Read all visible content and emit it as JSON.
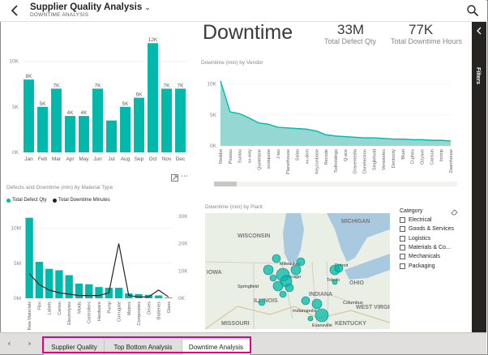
{
  "header": {
    "title": "Supplier Quality Analysis",
    "subtitle": "DOWNTIME ANALYSIS"
  },
  "filters": {
    "label": "Filters"
  },
  "downtime_heading": "Downtime",
  "kpis": [
    {
      "value": "33M",
      "label": "Total Defect Qty"
    },
    {
      "value": "77K",
      "label": "Total Downtime Hours"
    }
  ],
  "colors": {
    "teal": "#01b8aa",
    "teal_light": "#8ad4ce",
    "dark_line": "#252423",
    "accent_tab": "#e3008c"
  },
  "chart_data": [
    {
      "type": "bar",
      "title": "",
      "categories": [
        "Jan",
        "Feb",
        "Mar",
        "Apr",
        "May",
        "Jun",
        "Jul",
        "Aug",
        "Sep",
        "Oct",
        "Nov",
        "Dec"
      ],
      "values": [
        8,
        5,
        7,
        4,
        4,
        7,
        3.5,
        5,
        6,
        12,
        7,
        7
      ],
      "data_labels": [
        "8K",
        "5K",
        "7K",
        "4K",
        "4K",
        "7K",
        "",
        "5K",
        "6K",
        "12K",
        "7K",
        "7K"
      ],
      "yticks": [
        "10K",
        "5K",
        "0K"
      ],
      "ylim": [
        0,
        13
      ]
    },
    {
      "type": "area",
      "title": "Downtime (min) by Vendor",
      "categories": [
        "Reddot",
        "Plustax",
        "Sunlax",
        "xx-way",
        "Quotelane",
        "scotquote",
        "J-tax",
        "Planethouse",
        "Salan",
        "xx-dom",
        "Keyzunbase",
        "Recode",
        "Solholdings",
        "Q-ace",
        "Gravemedia",
        "Donelectron",
        "Singlehold",
        "Ventotelex",
        "Dentocity",
        "Bluet",
        "D-phex",
        "Ozyaxe",
        "Cansun",
        "Inctrip",
        "Zaamhouse"
      ],
      "values": [
        10.5,
        5.5,
        5.2,
        4.5,
        3.7,
        3.5,
        3.0,
        2.9,
        2.8,
        2.7,
        2.4,
        1.8,
        1.6,
        1.5,
        1.4,
        1.3,
        1.3,
        1.2,
        1.1,
        1.1,
        1.0,
        1.0,
        0.9,
        0.9,
        0.8
      ],
      "yticks": [
        "10K",
        "5K",
        "0K"
      ],
      "ylim": [
        0,
        11
      ]
    },
    {
      "type": "bar",
      "title": "Defects and Downtime (min) by Material Type",
      "legend": [
        "Total Defect Qty",
        "Total Downtime Minutes"
      ],
      "categories": [
        "Raw Materials",
        "Film",
        "Labels",
        "Carton",
        "Electrolytes",
        "Molds",
        "Controllers",
        "Hardware",
        "Pump",
        "Corrugate",
        "Motors",
        "Composites",
        "Drives",
        "Batteries",
        "Glass"
      ],
      "series": [
        {
          "name": "Total Defect Qty",
          "values": [
            11.5,
            5.2,
            4.2,
            4.0,
            3.3,
            2.1,
            2.0,
            1.6,
            1.5,
            1.5,
            0.7,
            0.6,
            0.5,
            0.4,
            0.1
          ]
        },
        {
          "name": "Total Downtime Minutes",
          "values": [
            9,
            5,
            3,
            2,
            1.5,
            1,
            1,
            1,
            2,
            20,
            1,
            0.5,
            0.5,
            3,
            0.5
          ]
        }
      ],
      "yticks_left": [
        "10M",
        "5M",
        "0M"
      ],
      "yticks_right": [
        "30K",
        "20K",
        "10K",
        "0K"
      ]
    }
  ],
  "map": {
    "title": "Downtime (min) by Plant",
    "labels": [
      "WISCONSIN",
      "MICHIGAN",
      "IOWA",
      "ILLINOIS",
      "INDIANA",
      "OHIO",
      "MISSOURI",
      "KENTUCKY",
      "WEST VIRGINIA",
      "Milwaukee",
      "Chicago",
      "Detroit",
      "Indianapolis",
      "Springfield",
      "Toledo",
      "Columbus",
      "Evansville"
    ]
  },
  "category_slicer": {
    "title": "Category",
    "items": [
      "Electrical",
      "Goods & Services",
      "Logistics",
      "Materials & Co...",
      "Mechanicals",
      "Packaging"
    ]
  },
  "tabs": [
    {
      "label": "Supplier Quality"
    },
    {
      "label": "Top Bottom Analysis"
    },
    {
      "label": "Downtime Analysis"
    }
  ]
}
